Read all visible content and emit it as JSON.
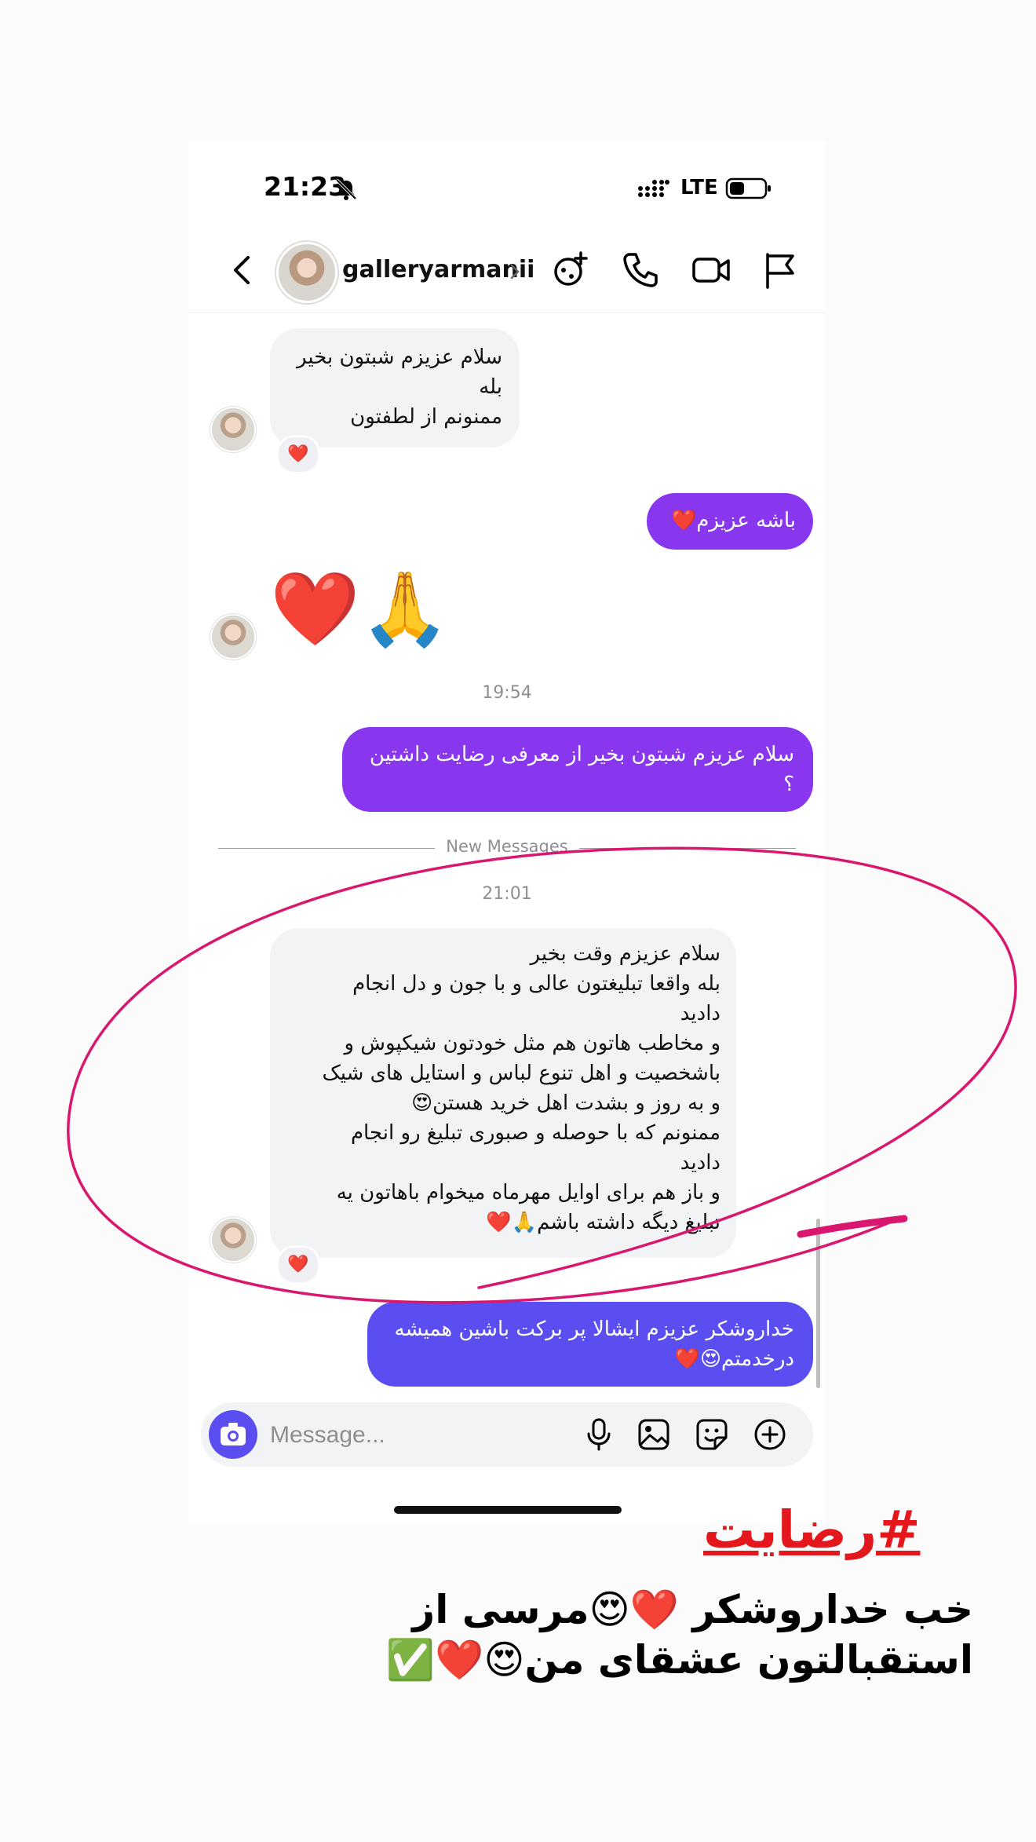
{
  "status_bar": {
    "time": "21:23",
    "network": "LTE",
    "icons": [
      "bell-slash-icon",
      "signal-icon",
      "battery-icon"
    ]
  },
  "header": {
    "contact_name": "galleryarmanii",
    "icons": [
      "back-chevron-icon",
      "avatar",
      "chevron-right-icon",
      "effects-icon",
      "phone-icon",
      "video-icon",
      "flag-icon"
    ]
  },
  "messages": {
    "m1": {
      "lines": [
        "سلام عزیزم شبتون بخیر",
        "بله",
        "ممنونم از لطفتون"
      ],
      "reaction": "❤️"
    },
    "m2": {
      "lines": [
        "باشه عزیزم❤️"
      ]
    },
    "m3": {
      "emojis": "❤️🙏"
    },
    "time_1": "19:54",
    "m4": {
      "lines": [
        "سلام عزیزم شبتون بخیر از معرفی رضایت داشتین",
        "؟"
      ]
    },
    "new_messages_label": "New Messages",
    "time_2": "21:01",
    "m5": {
      "lines": [
        "سلام عزیزم وقت بخیر",
        "بله واقعا تبلیغتون عالی و با جون و دل انجام",
        "دادید",
        "و مخاطب هاتون هم مثل خودتون شیکپوش و",
        "باشخصیت و اهل تنوع لباس و استایل های شیک",
        "و به روز و بشدت اهل خرید هستن😍",
        "ممنونم که با حوصله و صبوری تبلیغ رو انجام",
        "دادید",
        "و باز هم برای اوایل مهرماه میخوام باهاتون یه",
        "تبلیغ دیگه داشته باشم🙏❤️"
      ],
      "reaction": "❤️"
    },
    "m6": {
      "lines": [
        "خداروشکر عزیزم ایشالا پر برکت باشین همیشه",
        "درخدمتم😍❤️"
      ]
    }
  },
  "composer": {
    "placeholder": "Message...",
    "icons": [
      "camera-icon",
      "microphone-icon",
      "gallery-icon",
      "sticker-icon",
      "plus-icon"
    ]
  },
  "overlay": {
    "hashtag": "#رضایت",
    "caption_lines": [
      "خب خداروشکر ❤️😍مرسی از",
      "استقبالتون عشقای من😍❤️✅"
    ],
    "annotation_color": "#d9176f"
  },
  "colors": {
    "outgoing_purple": "#8937ee",
    "outgoing_blue": "#5b4ef0",
    "incoming": "#f2f3f5",
    "hashtag_red": "#e3171c"
  }
}
